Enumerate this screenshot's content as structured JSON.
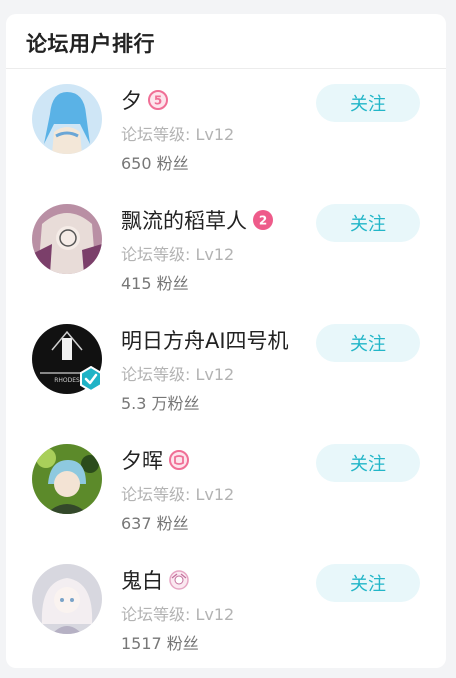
{
  "panel": {
    "title": "论坛用户排行"
  },
  "users": [
    {
      "name": "夕",
      "level": "论坛等级: Lv12",
      "fans": "650 粉丝",
      "follow_label": "关注",
      "badge": "5",
      "badge_color": "#f06f96",
      "verified": false,
      "avatar_colors": [
        "#cfe6f6",
        "#5ab2e6",
        "#f3e7d8"
      ]
    },
    {
      "name": "飘流的稻草人",
      "level": "论坛等级: Lv12",
      "fans": "415 粉丝",
      "follow_label": "关注",
      "badge": "2",
      "badge_color": "#ee5b8a",
      "verified": false,
      "avatar_colors": [
        "#b98fa4",
        "#e8dcd8",
        "#7b3f6a"
      ]
    },
    {
      "name": "明日方舟AI四号机",
      "level": "论坛等级: Lv12",
      "fans": "5.3 万粉丝",
      "follow_label": "关注",
      "badge": "",
      "badge_color": "",
      "verified": true,
      "avatar_colors": [
        "#111111",
        "#2a2a2a",
        "#f1f1f1"
      ]
    },
    {
      "name": "夕晖",
      "level": "论坛等级: Lv12",
      "fans": "637 粉丝",
      "follow_label": "关注",
      "badge": "",
      "badge_color": "#f06f96",
      "verified": false,
      "avatar_colors": [
        "#5c8a2a",
        "#2b4c1b",
        "#8ec9df"
      ]
    },
    {
      "name": "鬼白",
      "level": "论坛等级: Lv12",
      "fans": "1517 粉丝",
      "follow_label": "关注",
      "badge": "",
      "badge_color": "#e6a7c4",
      "verified": false,
      "avatar_colors": [
        "#d7d7df",
        "#f3eef1",
        "#b6b1c4"
      ]
    }
  ],
  "colors": {
    "accent": "#22b6c8",
    "follow_bg": "#e8f7fa",
    "level_text": "#b3b3b3",
    "fans_text": "#777777"
  }
}
